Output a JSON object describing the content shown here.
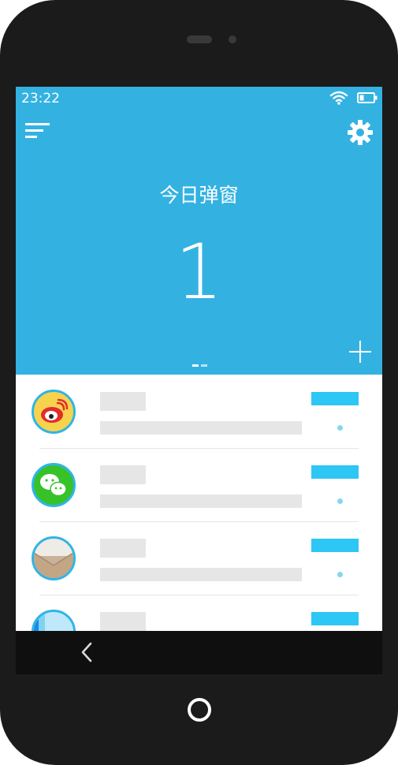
{
  "status_bar": {
    "time": "23:22",
    "icons": [
      "wifi-icon",
      "battery-icon"
    ]
  },
  "header": {
    "title": "今日弹窗",
    "count": "1",
    "menu_icon": "menu-icon",
    "settings_icon": "gear-icon",
    "add_icon": "plus-icon",
    "page_count": 2,
    "active_page": 1,
    "background_color": "#33b2e2"
  },
  "apps": [
    {
      "icon": "weibo-icon"
    },
    {
      "icon": "wechat-icon"
    },
    {
      "icon": "mail-icon"
    },
    {
      "icon": "app-icon"
    }
  ],
  "colors": {
    "accent": "#2ec6f5",
    "placeholder": "#e6e6e6",
    "device": "#1c1b1c"
  },
  "nav": {
    "back_icon": "back-chevron-icon",
    "home_icon": "home-button-icon"
  }
}
